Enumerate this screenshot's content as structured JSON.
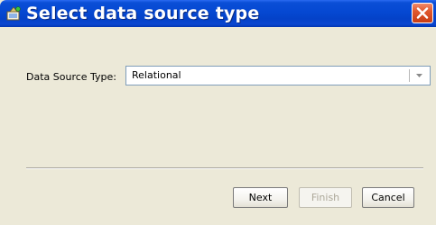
{
  "window": {
    "title": "Select data source type",
    "icon": "wizard-app-icon",
    "close_icon": "close-icon"
  },
  "form": {
    "data_source_type_label": "Data Source Type:",
    "data_source_type_value": "Relational",
    "dropdown_icon": "chevron-down-icon"
  },
  "buttons": {
    "next": "Next",
    "finish": "Finish",
    "cancel": "Cancel",
    "finish_enabled": false
  },
  "colors": {
    "titlebar": "#0548d2",
    "close_button": "#e0582e",
    "dialog_background": "#ece9d8"
  }
}
